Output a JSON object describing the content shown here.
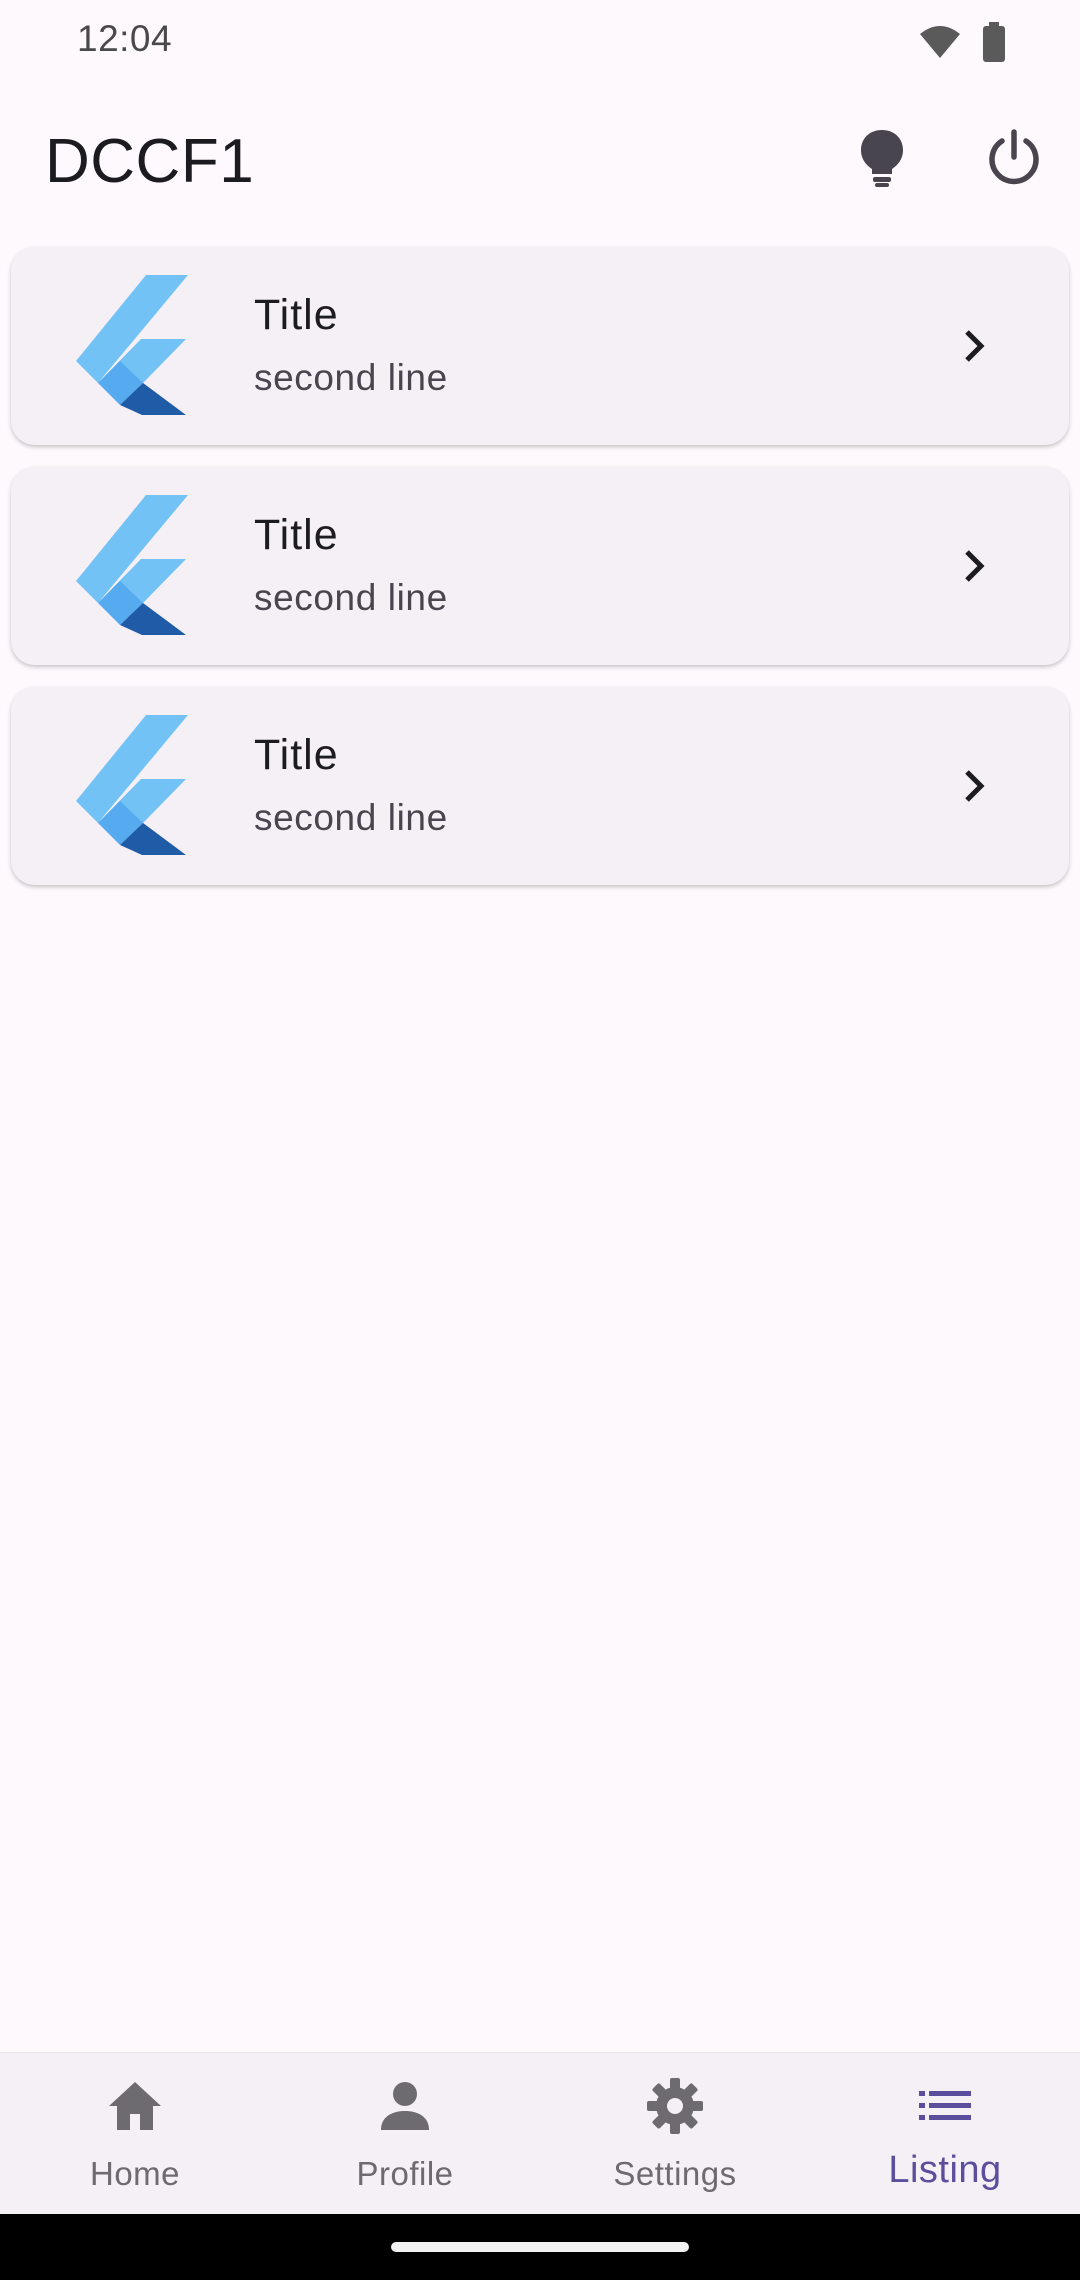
{
  "status_bar": {
    "time": "12:04"
  },
  "app_bar": {
    "title": "DCCF1"
  },
  "list_items": [
    {
      "title": "Title",
      "subtitle": "second line"
    },
    {
      "title": "Title",
      "subtitle": "second line"
    },
    {
      "title": "Title",
      "subtitle": "second line"
    }
  ],
  "bottom_nav": {
    "items": [
      {
        "label": "Home",
        "icon": "home-icon"
      },
      {
        "label": "Profile",
        "icon": "person-icon"
      },
      {
        "label": "Settings",
        "icon": "gear-icon"
      },
      {
        "label": "Listing",
        "icon": "list-icon"
      }
    ],
    "active": "Listing"
  },
  "colors": {
    "background": "#fdf9fd",
    "card": "#f4f0f5",
    "accent": "#5b4e9d",
    "logo_light": "#72c2f6",
    "logo_mid": "#55aaf0",
    "logo_dark": "#1f5ba6"
  }
}
